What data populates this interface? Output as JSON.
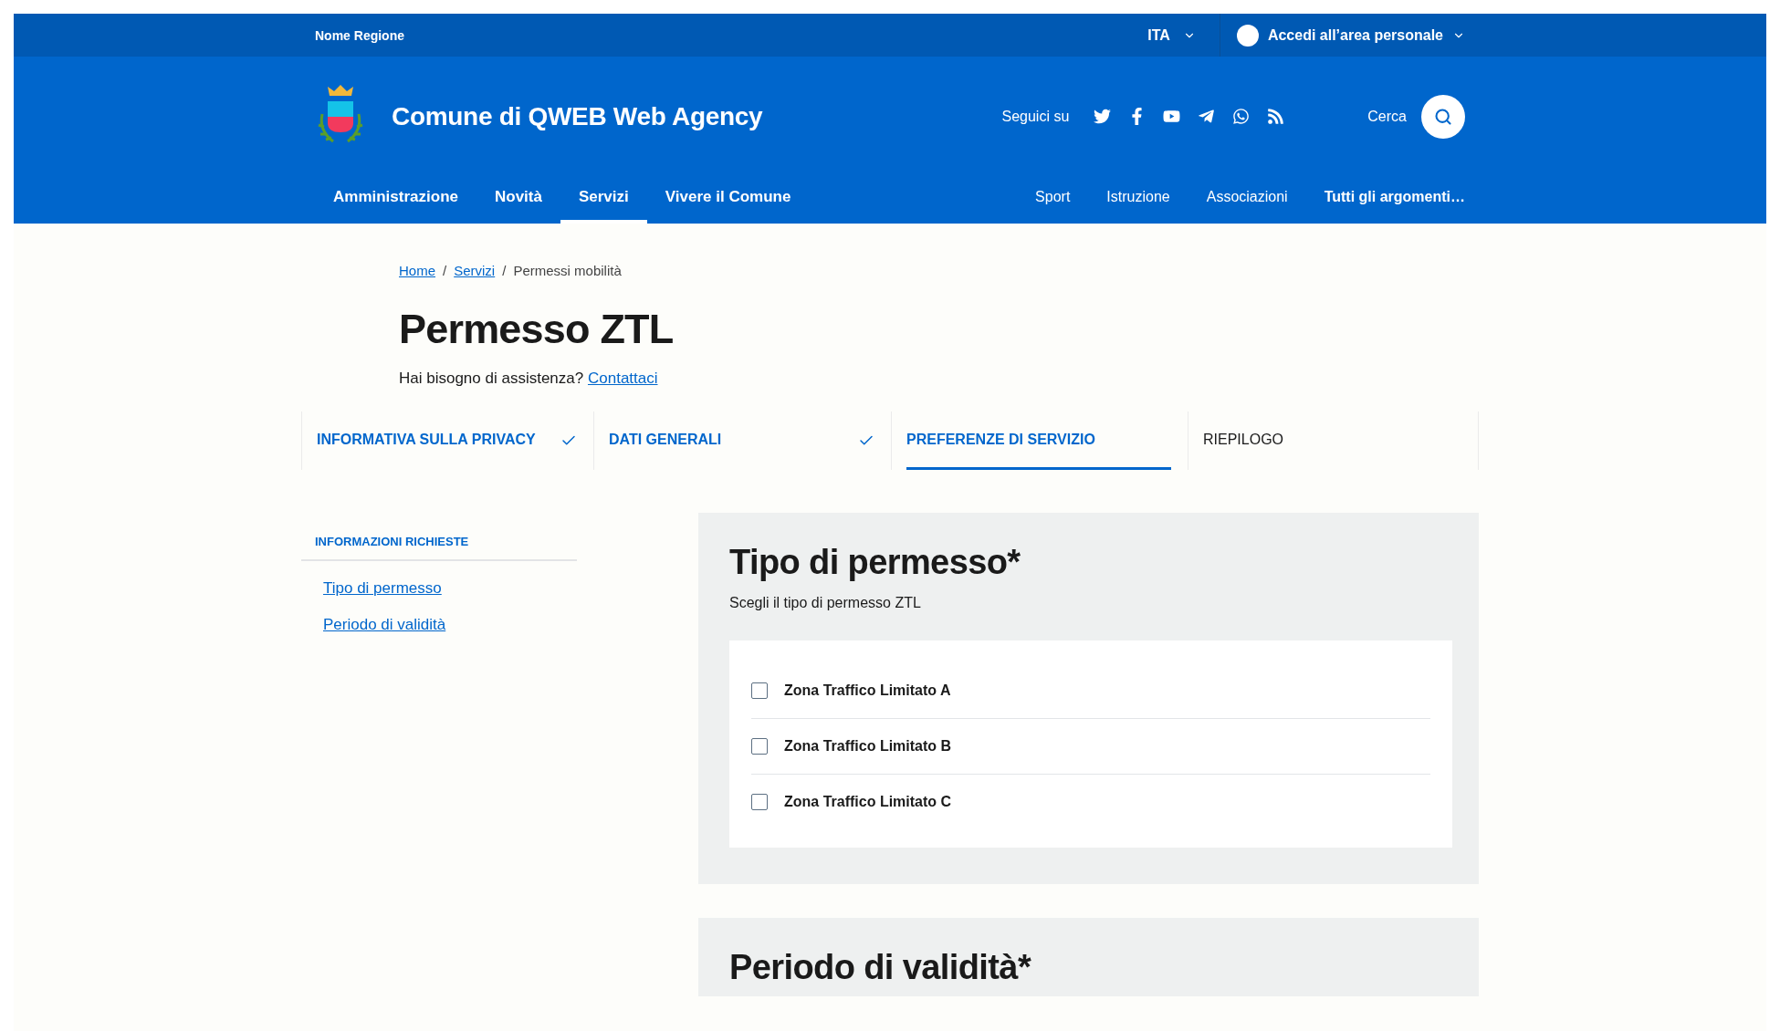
{
  "top_bar": {
    "region": "Nome Regione",
    "language": "ITA",
    "login": "Accedi all’area personale"
  },
  "header": {
    "title": "Comune di QWEB Web Agency",
    "follow_label": "Seguici su",
    "search_label": "Cerca"
  },
  "main_nav": [
    {
      "label": "Amministrazione",
      "selected": false
    },
    {
      "label": "Novità",
      "selected": false
    },
    {
      "label": "Servizi",
      "selected": true
    },
    {
      "label": "Vivere il Comune",
      "selected": false
    }
  ],
  "topics_nav": [
    {
      "label": "Sport",
      "kind": "topic"
    },
    {
      "label": "Istruzione",
      "kind": "topic"
    },
    {
      "label": "Associazioni",
      "kind": "topic"
    },
    {
      "label": "Tutti gli argomenti…",
      "kind": "all"
    }
  ],
  "breadcrumb_separator": "/",
  "breadcrumb": [
    {
      "label": "Home",
      "kind": "link"
    },
    {
      "label": "Servizi",
      "kind": "link"
    },
    {
      "label": "Permessi mobilità",
      "kind": "current"
    }
  ],
  "page": {
    "title": "Permesso ZTL",
    "help_text": "Hai bisogno di assistenza?",
    "help_link": "Contattaci"
  },
  "steps": [
    {
      "label": "INFORMATIVA SULLA PRIVACY",
      "completed": true,
      "selected": false
    },
    {
      "label": "DATI GENERALI",
      "completed": true,
      "selected": false
    },
    {
      "label": "PREFERENZE DI SERVIZIO",
      "completed": false,
      "selected": true
    },
    {
      "label": "RIEPILOGO",
      "completed": false,
      "selected": false
    }
  ],
  "sidebar": {
    "title": "INFORMAZIONI RICHIESTE",
    "links": [
      "Tipo di permesso",
      "Periodo di validità"
    ]
  },
  "sections": [
    {
      "title": "Tipo di permesso*",
      "subtitle": "Scegli il tipo di permesso ZTL",
      "options": [
        {
          "label": "Zona Traffico Limitato A",
          "checked": false
        },
        {
          "label": "Zona Traffico Limitato B",
          "checked": false
        },
        {
          "label": "Zona Traffico Limitato C",
          "checked": false
        }
      ]
    },
    {
      "title": "Periodo di validità*"
    }
  ]
}
